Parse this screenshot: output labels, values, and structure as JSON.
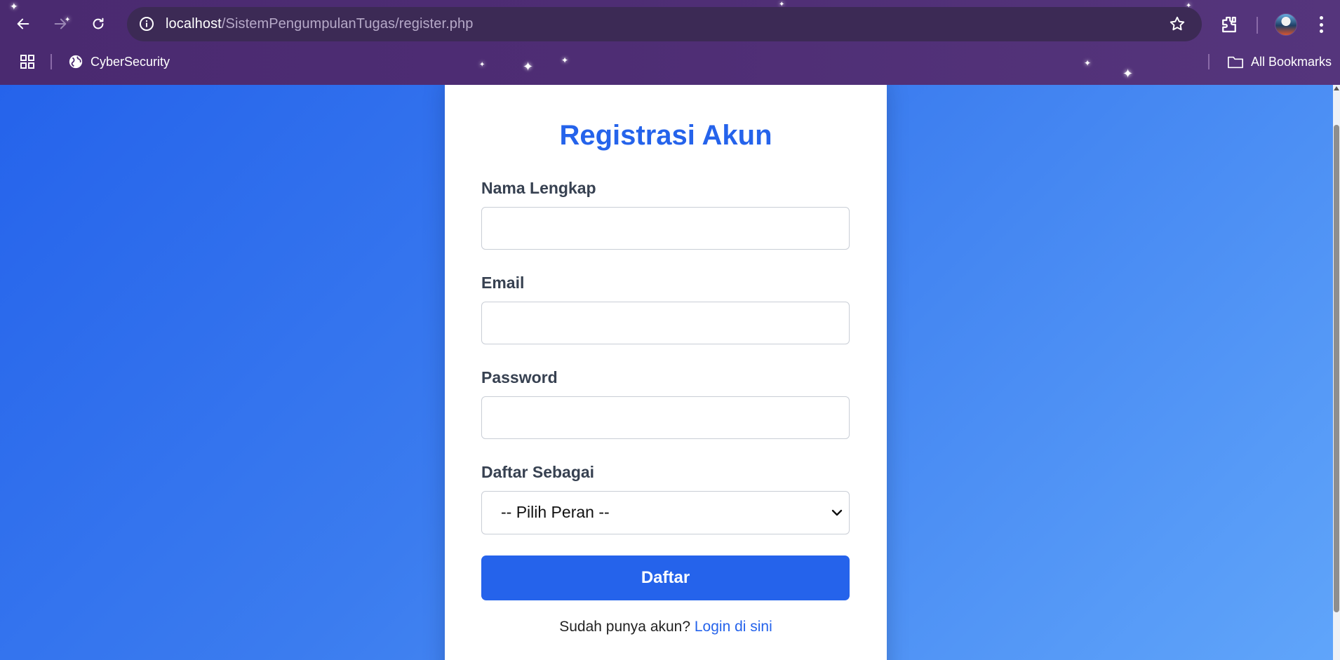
{
  "browser": {
    "url_host": "localhost",
    "url_path": "/SistemPengumpulanTugas/register.php",
    "bookmark_label": "CyberSecurity",
    "all_bookmarks_label": "All Bookmarks",
    "theme_color": "#4e2d74"
  },
  "form": {
    "title": "Registrasi Akun",
    "fields": [
      {
        "label": "Nama Lengkap",
        "value": "",
        "type": "text"
      },
      {
        "label": "Email",
        "value": "",
        "type": "email"
      },
      {
        "label": "Password",
        "value": "",
        "type": "password"
      }
    ],
    "role": {
      "label": "Daftar Sebagai",
      "selected": "-- Pilih Peran --"
    },
    "submit_label": "Daftar",
    "footer_text": "Sudah punya akun?",
    "footer_link": "Login di sini",
    "accent_color": "#2563eb"
  }
}
